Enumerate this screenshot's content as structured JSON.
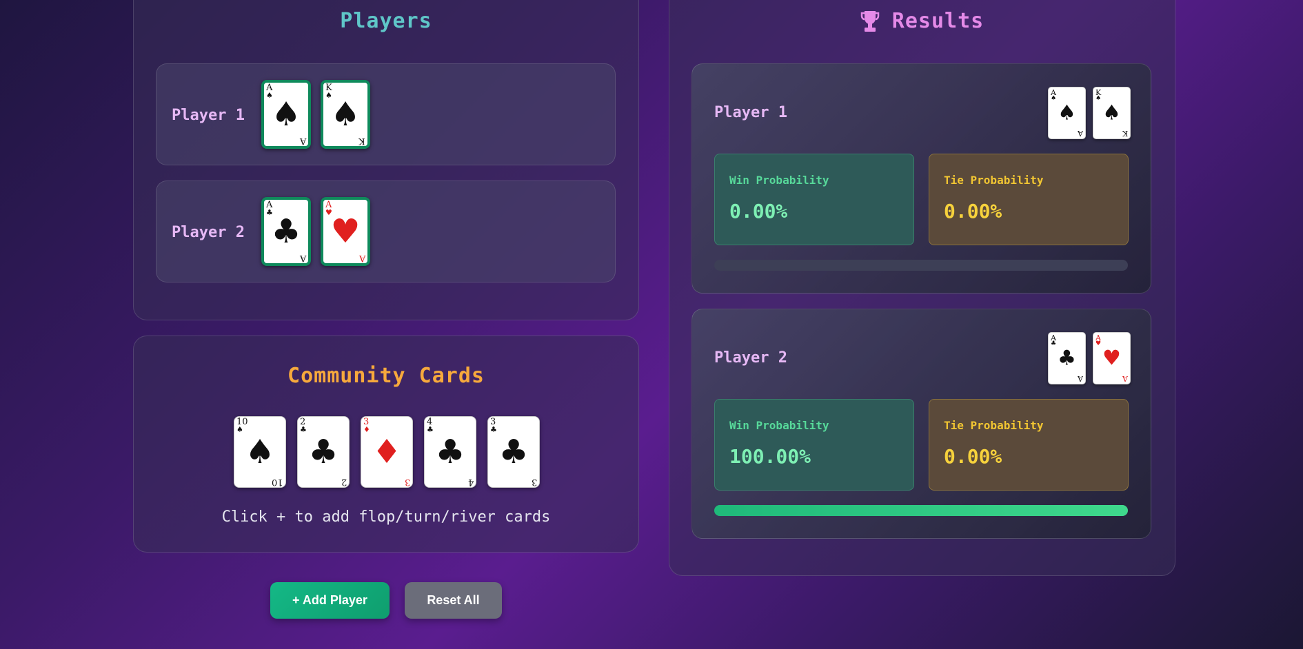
{
  "players_panel": {
    "title": "Players",
    "players": [
      {
        "name": "Player 1",
        "cards": [
          {
            "rank": "A",
            "suit": "♠",
            "color": "black"
          },
          {
            "rank": "K",
            "suit": "♠",
            "color": "black"
          }
        ]
      },
      {
        "name": "Player 2",
        "cards": [
          {
            "rank": "A",
            "suit": "♣",
            "color": "black"
          },
          {
            "rank": "A",
            "suit": "♥",
            "color": "red"
          }
        ]
      }
    ]
  },
  "community_panel": {
    "title": "Community Cards",
    "cards": [
      {
        "rank": "10",
        "suit": "♠",
        "color": "black"
      },
      {
        "rank": "2",
        "suit": "♣",
        "color": "black"
      },
      {
        "rank": "3",
        "suit": "♦",
        "color": "red"
      },
      {
        "rank": "4",
        "suit": "♣",
        "color": "black"
      },
      {
        "rank": "3",
        "suit": "♣",
        "color": "black"
      }
    ],
    "hint": "Click + to add flop/turn/river cards"
  },
  "results_panel": {
    "title": "Results",
    "title_icon": "trophy-icon",
    "results": [
      {
        "name": "Player 1",
        "cards": [
          {
            "rank": "A",
            "suit": "♠",
            "color": "black"
          },
          {
            "rank": "K",
            "suit": "♠",
            "color": "black"
          }
        ],
        "win_label": "Win Probability",
        "win_value": "0.00%",
        "tie_label": "Tie Probability",
        "tie_value": "0.00%",
        "win_fraction": 0.0
      },
      {
        "name": "Player 2",
        "cards": [
          {
            "rank": "A",
            "suit": "♣",
            "color": "black"
          },
          {
            "rank": "A",
            "suit": "♥",
            "color": "red"
          }
        ],
        "win_label": "Win Probability",
        "win_value": "100.00%",
        "tie_label": "Tie Probability",
        "tie_value": "0.00%",
        "win_fraction": 1.0
      }
    ]
  },
  "buttons": {
    "add_player": "+ Add Player",
    "reset_all": "Reset All"
  },
  "colors": {
    "players_title": "#5fc6c8",
    "community_title": "#f7a93c",
    "results_title": "#e58ae8",
    "card_border": "#0f8a5c",
    "win_green": "#57d99a",
    "tie_yellow": "#f2c632"
  }
}
